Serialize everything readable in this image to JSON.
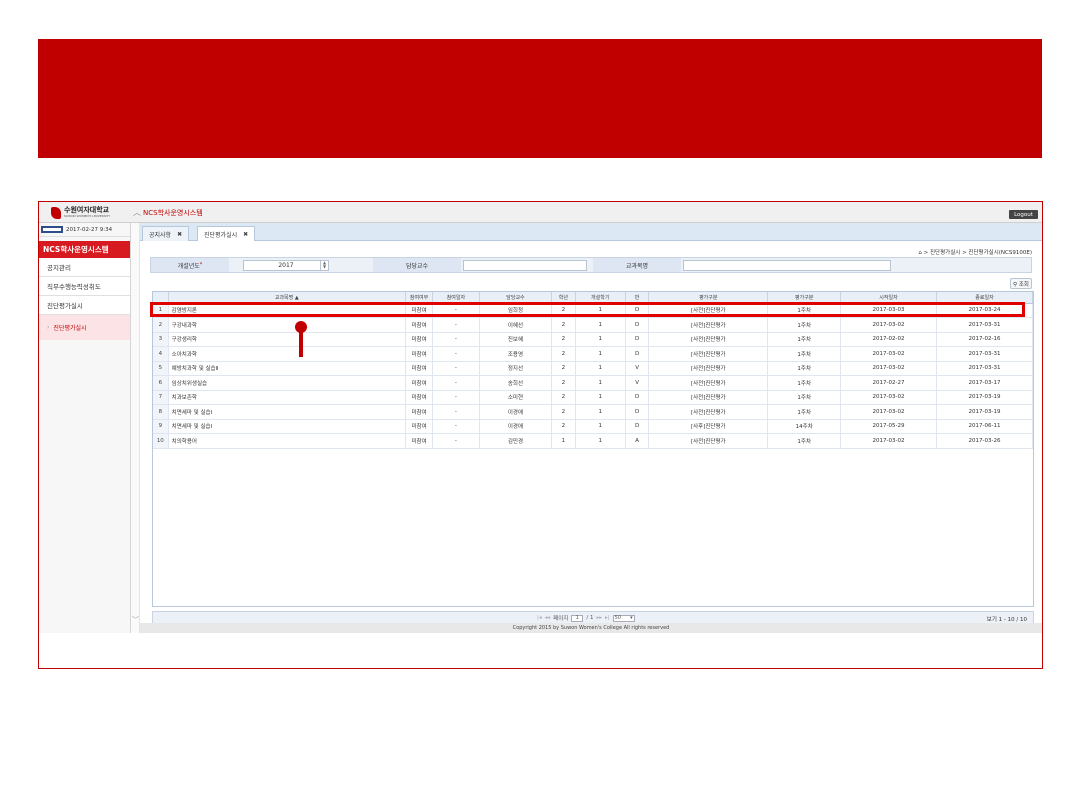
{
  "app": {
    "logo_text": "수원여자대학교",
    "logo_sub": "SUWON WOMEN'S UNIVERSITY",
    "system_title": "NCS학사운영시스템",
    "logout_label": "Logout"
  },
  "user": {
    "datetime": "2017-02-27 9:34"
  },
  "sidebar": {
    "header": "NCS학사운영시스템",
    "items": [
      {
        "label": "공지관리"
      },
      {
        "label": "직무수행능력성취도"
      },
      {
        "label": "진단평가실시"
      }
    ],
    "sub_item": "진단평가실시"
  },
  "tabs": [
    {
      "label": "공지사항",
      "close": "✖"
    },
    {
      "label": "진단평가실시",
      "close": "✖"
    }
  ],
  "breadcrumb": "⌂ > 진단평가실시 > 진단평가실시(NCS9100E)",
  "search": {
    "year_label": "개설년도",
    "year_required": "*",
    "year_value": "2017",
    "professor_label": "담당교수",
    "professor_value": "",
    "subject_label": "교과목명",
    "subject_value": "",
    "button_label": "⚲ 조회"
  },
  "table": {
    "columns": [
      "",
      "교과목명 ▲",
      "참여여부",
      "참여일자",
      "담당교수",
      "학년",
      "개설학기",
      "반",
      "평가구분",
      "평가구분",
      "시작일자",
      "종료일자"
    ],
    "rows": [
      [
        "1",
        "감염방지론",
        "미참여",
        "-",
        "임희정",
        "2",
        "1",
        "D",
        "[사전]진단평가",
        "1주차",
        "2017-03-03",
        "2017-03-24"
      ],
      [
        "2",
        "구강내과학",
        "미참여",
        "-",
        "이혜선",
        "2",
        "1",
        "D",
        "[사전]진단평가",
        "1주차",
        "2017-03-02",
        "2017-03-31"
      ],
      [
        "3",
        "구강생리학",
        "미참여",
        "-",
        "진보혜",
        "2",
        "1",
        "D",
        "[사전]진단평가",
        "1주차",
        "2017-02-02",
        "2017-02-16"
      ],
      [
        "4",
        "소아치과학",
        "미참여",
        "-",
        "조용영",
        "2",
        "1",
        "D",
        "[사전]진단평가",
        "1주차",
        "2017-03-02",
        "2017-03-31"
      ],
      [
        "5",
        "예방치과학 및 실습Ⅱ",
        "미참여",
        "-",
        "정지선",
        "2",
        "1",
        "V",
        "[사전]진단평가",
        "1주차",
        "2017-03-02",
        "2017-03-31"
      ],
      [
        "6",
        "임상치위생실습",
        "미참여",
        "-",
        "송희선",
        "2",
        "1",
        "V",
        "[사전]진단평가",
        "1주차",
        "2017-02-27",
        "2017-03-17"
      ],
      [
        "7",
        "치과보존학",
        "미참여",
        "-",
        "소미현",
        "2",
        "1",
        "D",
        "[사전]진단평가",
        "1주차",
        "2017-03-02",
        "2017-03-19"
      ],
      [
        "8",
        "치면세마 및 실습Ⅰ",
        "미참여",
        "-",
        "이경애",
        "2",
        "1",
        "D",
        "[사전]진단평가",
        "1주차",
        "2017-03-02",
        "2017-03-19"
      ],
      [
        "9",
        "치면세마 및 실습Ⅰ",
        "미참여",
        "-",
        "이경애",
        "2",
        "1",
        "D",
        "[사후]진단평가",
        "14주차",
        "2017-05-29",
        "2017-06-11"
      ],
      [
        "10",
        "치의학용어",
        "미참여",
        "-",
        "김민경",
        "1",
        "1",
        "A",
        "[사전]진단평가",
        "1주차",
        "2017-03-02",
        "2017-03-26"
      ]
    ]
  },
  "pager": {
    "page_label": "페이지",
    "page_value": "1",
    "page_total": "/ 1",
    "page_size": "50",
    "view_info": "보기 1 - 10 / 10"
  },
  "footer": "Copyright 2015 by Suwon Women's College All rights reserved",
  "colors": {
    "brand_red": "#c00000",
    "highlight_red": "#e00000"
  }
}
